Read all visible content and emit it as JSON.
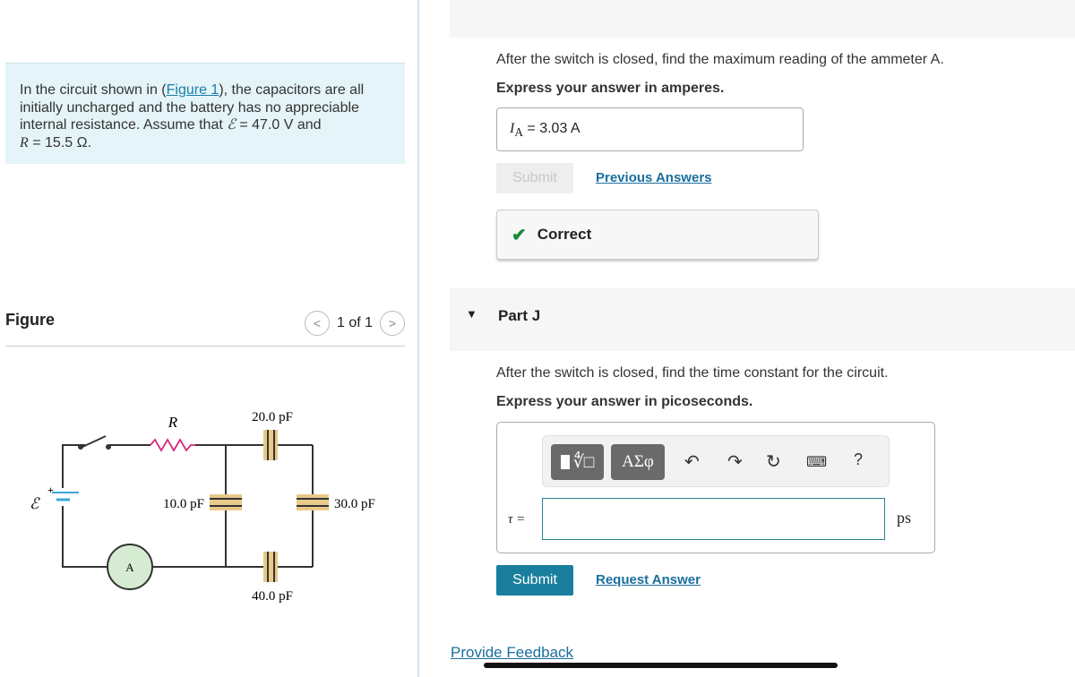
{
  "problem": {
    "text_before_link": "In the circuit shown in (",
    "link": "Figure 1",
    "text_after_link": "), the capacitors are all initially uncharged and the battery has no appreciable internal resistance. Assume that ",
    "emf_symbol": "ℰ",
    "emf_value": " = 47.0 V and",
    "r_symbol": "R",
    "r_value": " = 15.5 Ω."
  },
  "figure": {
    "title": "Figure",
    "pager": "1 of 1",
    "prev": "<",
    "next": ">",
    "labels": {
      "R": "R",
      "emf": "ℰ",
      "plus": "+",
      "c1": "20.0 pF",
      "c2": "10.0 pF",
      "c3": "30.0 pF",
      "c4": "40.0 pF",
      "ammeter": "A"
    }
  },
  "part_i": {
    "question": "After the switch is closed, find the maximum reading of the ammeter A.",
    "instruction": "Express your answer in amperes.",
    "var": "I",
    "sub": "A",
    "answer": " = 3.03  A",
    "submit": "Submit",
    "previous": "Previous Answers",
    "feedback": "Correct"
  },
  "part_j": {
    "title": "Part J",
    "question": "After the switch is closed, find the time constant for the circuit.",
    "instruction": "Express your answer in picoseconds.",
    "var": "τ =",
    "value": "",
    "unit": "ps",
    "toolbar": {
      "greek": "ΑΣφ",
      "help": "?"
    },
    "submit": "Submit",
    "request": "Request Answer"
  },
  "footer": {
    "feedback": "Provide Feedback"
  },
  "colors": {
    "accent": "#1a7f9e",
    "correct": "#1a8a3a"
  }
}
